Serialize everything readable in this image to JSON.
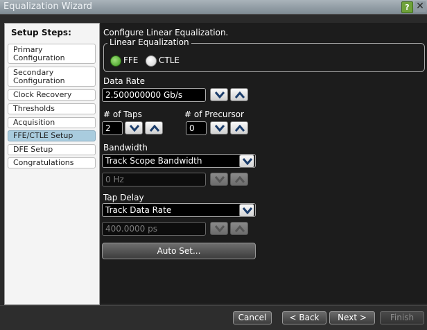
{
  "window": {
    "title": "Equalization Wizard",
    "help_label": "?",
    "close_label": "✕"
  },
  "steps": {
    "header": "Setup Steps:",
    "items": [
      {
        "label": "Primary Configuration"
      },
      {
        "label": "Secondary Configuration"
      },
      {
        "label": "Clock Recovery"
      },
      {
        "label": "Thresholds"
      },
      {
        "label": "Acquisition"
      },
      {
        "label": "FFE/CTLE Setup",
        "active": true
      },
      {
        "label": "DFE Setup"
      },
      {
        "label": "Congratulations"
      }
    ]
  },
  "main": {
    "heading": "Configure Linear Equalization.",
    "eq_group": "Linear Equalization",
    "ffe_label": "FFE",
    "ctle_label": "CTLE",
    "selected": "FFE",
    "data_rate_label": "Data Rate",
    "data_rate_value": "2.500000000 Gb/s",
    "taps_label": "# of Taps",
    "taps_value": "2",
    "precursor_label": "# of Precursor",
    "precursor_value": "0",
    "bandwidth_label": "Bandwidth",
    "bandwidth_mode": "Track Scope Bandwidth",
    "bandwidth_value": "0 Hz",
    "tap_delay_label": "Tap Delay",
    "tap_delay_mode": "Track Data Rate",
    "tap_delay_value": "400.0000 ps",
    "auto_set_label": "Auto Set..."
  },
  "footer": {
    "cancel": "Cancel",
    "back": "< Back",
    "next": "Next >",
    "finish": "Finish"
  },
  "colors": {
    "accent_green": "#4aa52a",
    "active_step": "#a9ccde",
    "panel_bg": "#1c1c1c"
  }
}
